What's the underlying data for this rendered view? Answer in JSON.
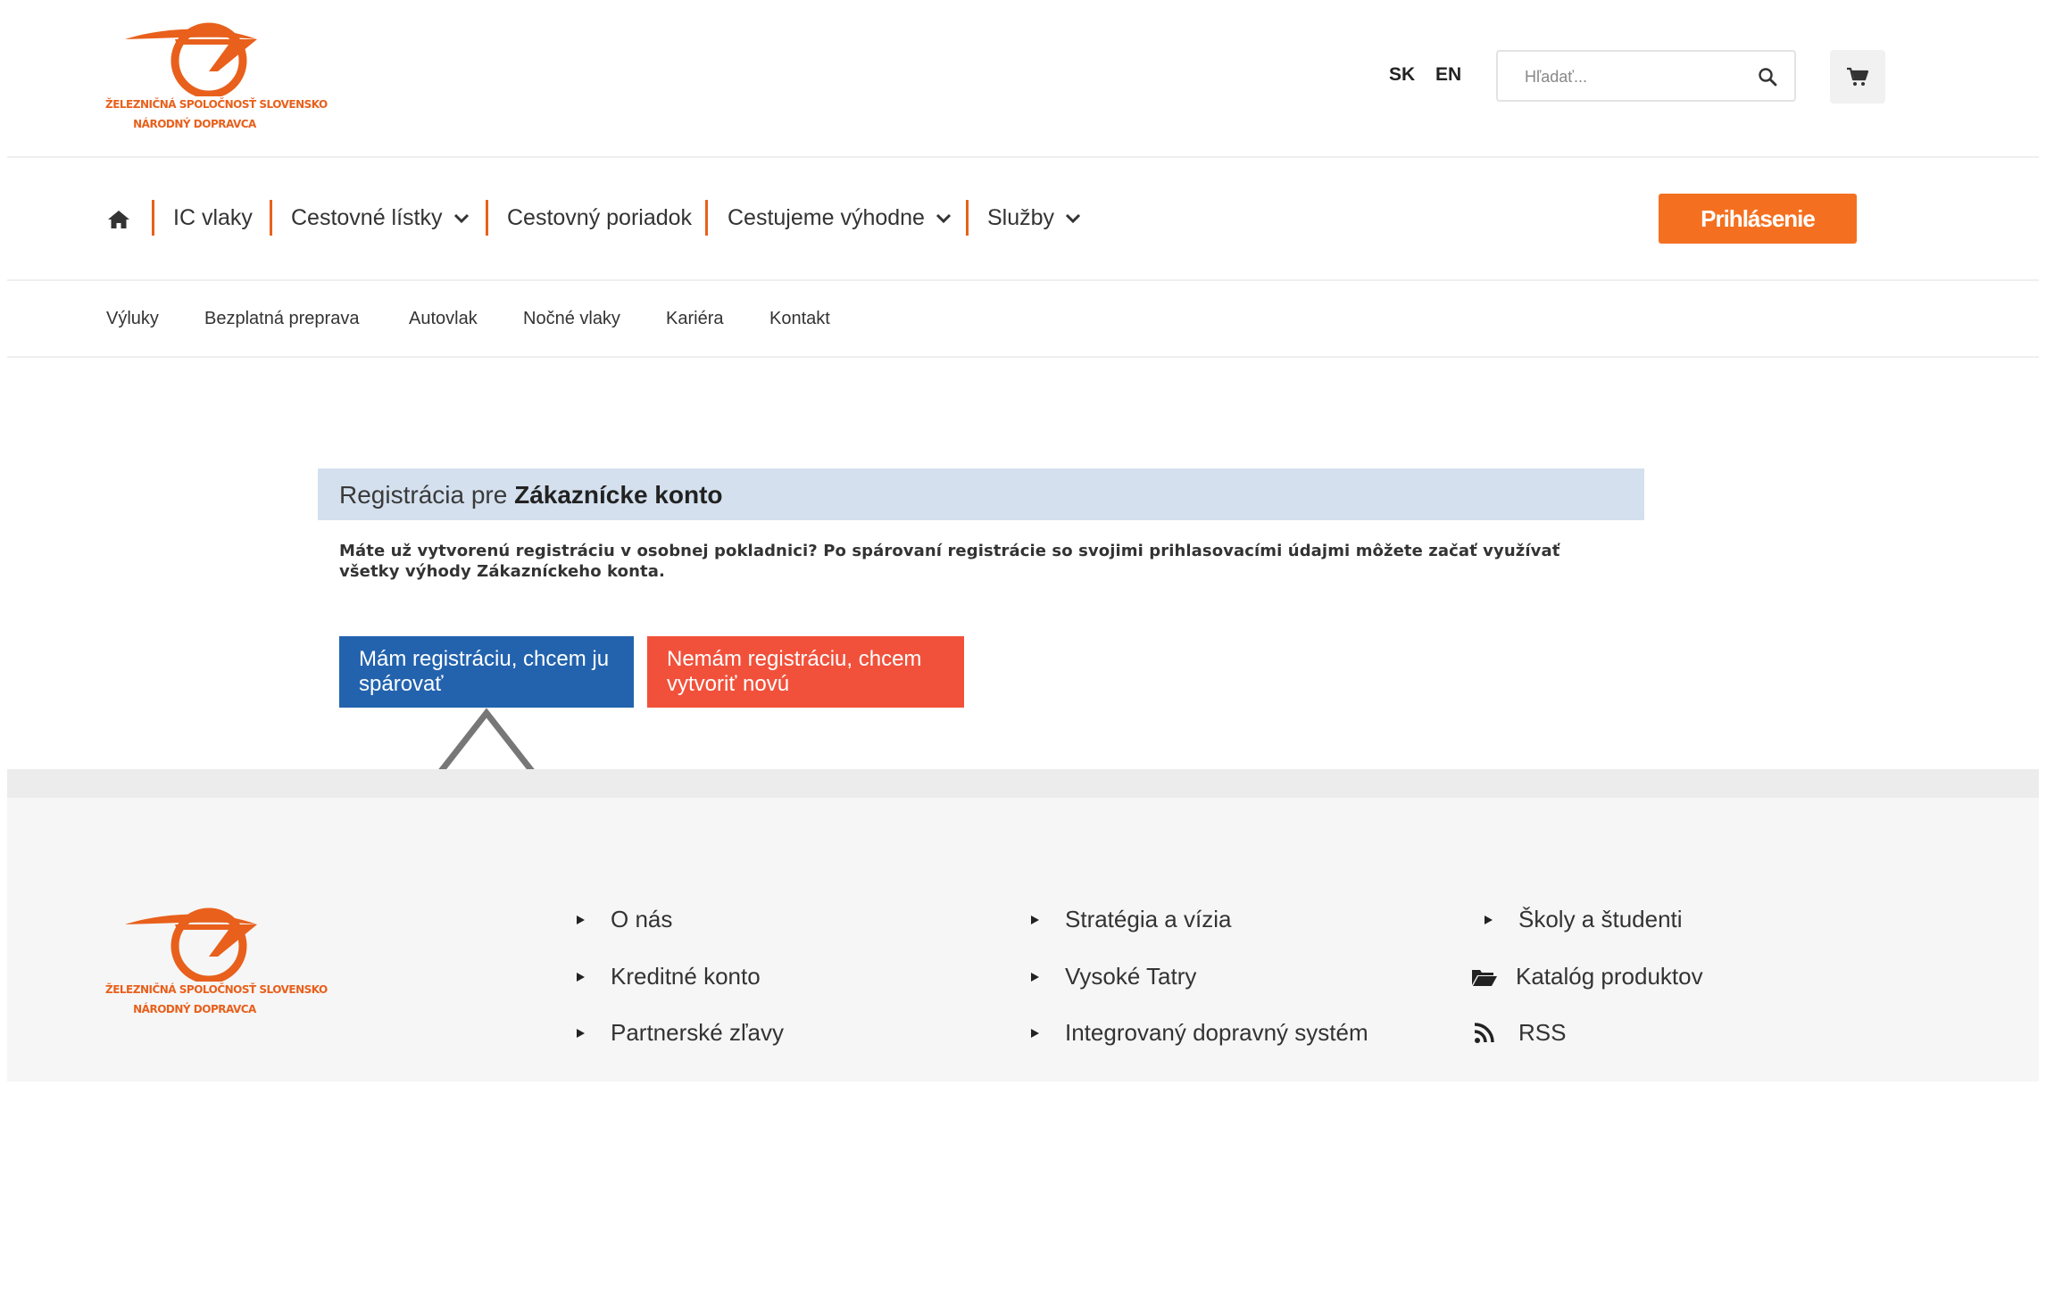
{
  "header": {
    "logo_line1": "ŽELEZNIČNÁ SPOLOČNOSŤ SLOVENSKO",
    "logo_line2": "NÁRODNÝ DOPRAVCA",
    "lang_sk": "SK",
    "lang_en": "EN",
    "search_placeholder": "Hľadať...",
    "search_value": ""
  },
  "nav": {
    "items": [
      {
        "label": "IC vlaky",
        "dropdown": false
      },
      {
        "label": "Cestovné lístky",
        "dropdown": true
      },
      {
        "label": "Cestovný poriadok",
        "dropdown": false
      },
      {
        "label": "Cestujeme výhodne",
        "dropdown": true
      },
      {
        "label": "Služby",
        "dropdown": true
      }
    ],
    "login_label": "Prihlásenie"
  },
  "subnav": {
    "items": [
      "Výluky",
      "Bezplatná preprava",
      "Autovlak",
      "Nočné vlaky",
      "Kariéra",
      "Kontakt"
    ]
  },
  "registration": {
    "title_prefix": "Registrácia pre",
    "title_bold": "Zákaznícke konto",
    "description": "Máte už vytvorenú registráciu v osobnej pokladnici? Po spárovaní registrácie so svojimi prihlasovacími údajmi môžete začať využívať všetky výhody Zákazníckeho konta.",
    "pair_button": "Mám registráciu, chcem ju spárovať",
    "create_button": "Nemám registráciu, chcem vytvoriť novú"
  },
  "footer": {
    "logo_line1": "ŽELEZNIČNÁ SPOLOČNOSŤ SLOVENSKO",
    "logo_line2": "NÁRODNÝ DOPRAVCA",
    "col1": [
      "O nás",
      "Kreditné konto",
      "Partnerské zľavy"
    ],
    "col2": [
      "Stratégia a vízia",
      "Vysoké Tatry",
      "Integrovaný dopravný systém"
    ],
    "col3": [
      "Školy a študenti",
      "Katalóg produktov",
      "RSS"
    ]
  },
  "colors": {
    "brand_orange": "#e8601c",
    "login_orange": "#f47020",
    "pair_blue": "#2363ae",
    "create_red": "#f1513b",
    "reg_header_bg": "#d4e0ee"
  }
}
